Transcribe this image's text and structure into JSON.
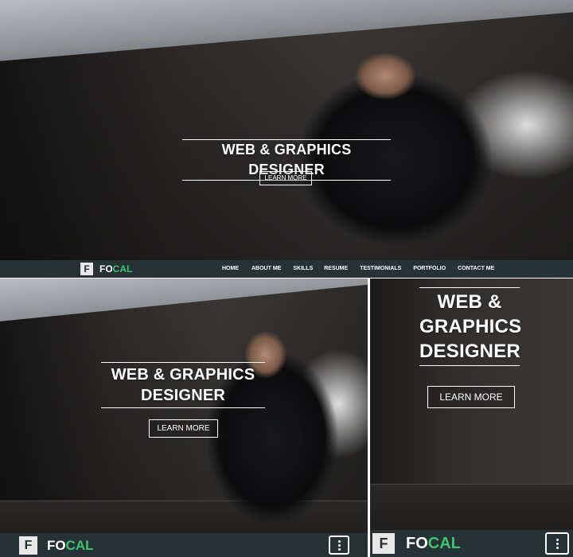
{
  "desktop": {
    "headline": "WEB & GRAPHICS DESIGNER",
    "cta_label": "LEARN MORE",
    "logo_letter": "F",
    "logo_fo": "FO",
    "logo_cal": "CAL",
    "nav": [
      "HOME",
      "ABOUT ME",
      "SKILLS",
      "RESUME",
      "TESTIMONIALS",
      "PORTFOLIO",
      "CONTACT ME"
    ]
  },
  "tablet": {
    "headline_line1": "WEB & GRAPHICS",
    "headline_line2": "DESIGNER",
    "cta_label": "LEARN MORE",
    "logo_letter": "F",
    "logo_fo": "FO",
    "logo_cal": "CAL"
  },
  "mobile": {
    "headline_line1": "WEB &",
    "headline_line2": "GRAPHICS",
    "headline_line3": "DESIGNER",
    "cta_label": "LEARN MORE",
    "logo_letter": "F",
    "logo_fo": "FO",
    "logo_cal": "CAL"
  },
  "colors": {
    "navbar": "#263236",
    "accent": "#3ec46d",
    "text": "#ffffff"
  },
  "icons": {
    "menu": "vertical-dots-icon",
    "logo": "letter-f-logo-icon"
  }
}
